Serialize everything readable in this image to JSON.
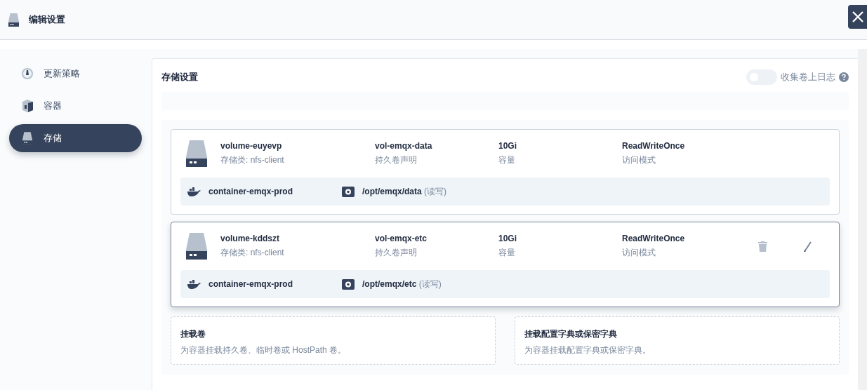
{
  "window": {
    "title": "编辑设置"
  },
  "sidebar": {
    "items": [
      {
        "label": "更新策略",
        "kind": "gauge",
        "selected": false
      },
      {
        "label": "容器",
        "kind": "box",
        "selected": false
      },
      {
        "label": "存储",
        "kind": "disk",
        "selected": true
      }
    ]
  },
  "storage": {
    "title": "存储设置",
    "log_toggle": {
      "label": "收集卷上日志",
      "on": false
    },
    "volumes": [
      {
        "name": "volume-euyevp",
        "storage_class": "存储类: nfs-client",
        "pvc": "vol-emqx-data",
        "pvc_label": "持久卷声明",
        "capacity": "10Gi",
        "capacity_label": "容量",
        "access": "ReadWriteOnce",
        "access_label": "访问模式",
        "selected": false,
        "mount": {
          "container": "container-emqx-prod",
          "path": "/opt/emqx/data",
          "mode": "(读写)"
        }
      },
      {
        "name": "volume-kddszt",
        "storage_class": "存储类: nfs-client",
        "pvc": "vol-emqx-etc",
        "pvc_label": "持久卷声明",
        "capacity": "10Gi",
        "capacity_label": "容量",
        "access": "ReadWriteOnce",
        "access_label": "访问模式",
        "selected": true,
        "mount": {
          "container": "container-emqx-prod",
          "path": "/opt/emqx/etc",
          "mode": "(读写)"
        }
      }
    ],
    "options": [
      {
        "title": "挂载卷",
        "description": "为容器挂载持久卷、临时卷或 HostPath 卷。"
      },
      {
        "title": "挂载配置字典或保密字典",
        "description": "为容器挂载配置字典或保密字典。"
      }
    ]
  }
}
